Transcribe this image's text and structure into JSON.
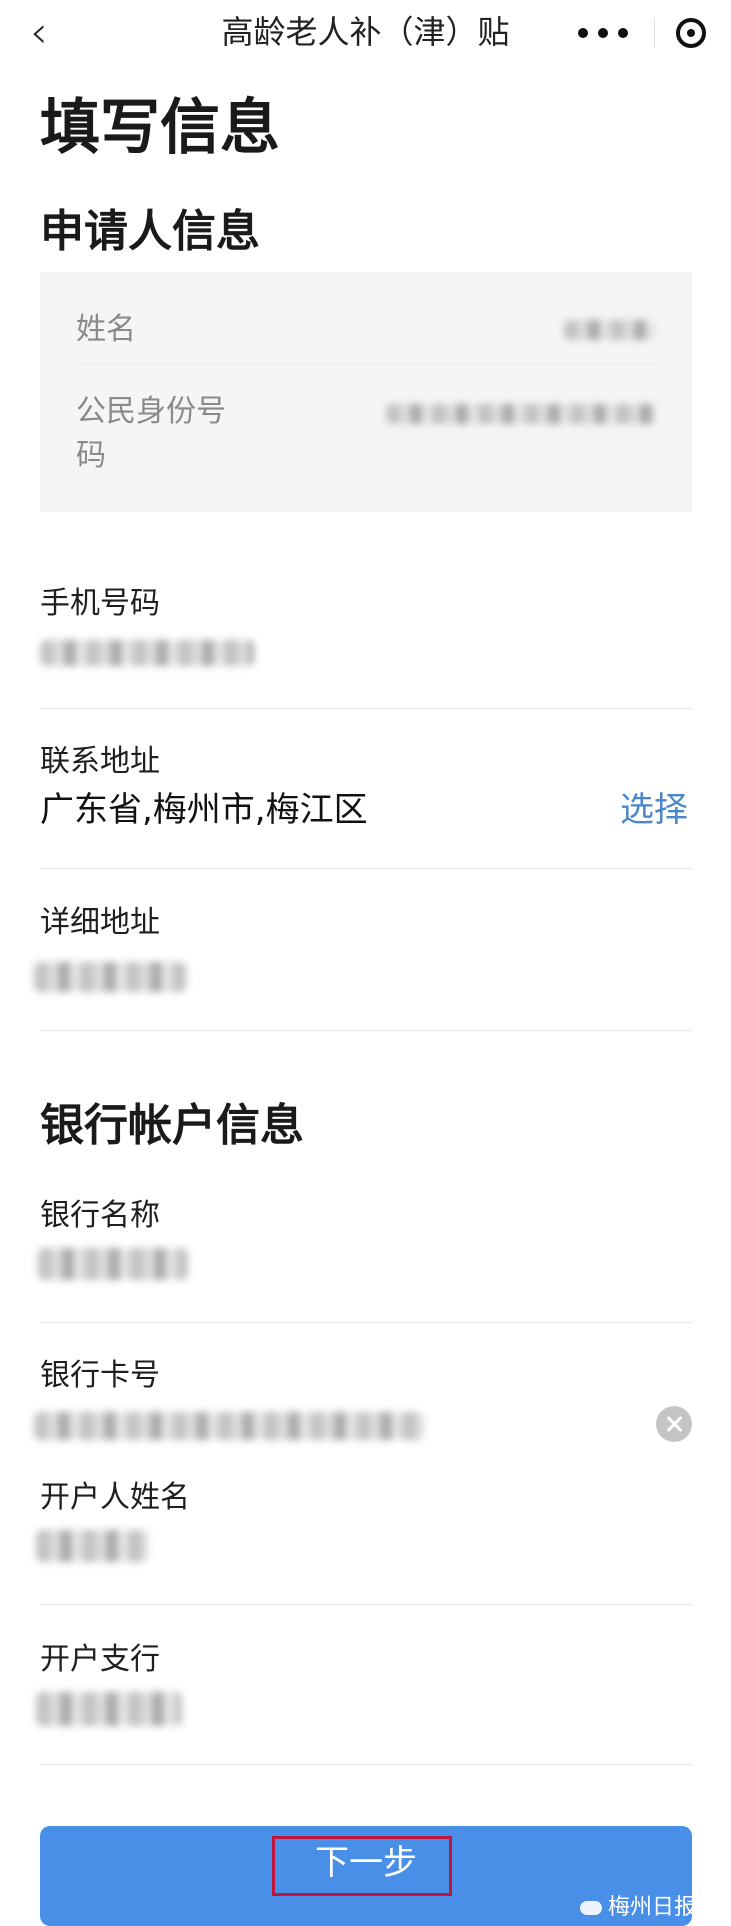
{
  "nav": {
    "title": "高龄老人补（津）贴"
  },
  "page_title": "填写信息",
  "applicant_section": {
    "title": "申请人信息",
    "name_label": "姓名",
    "id_label_line1": "公民身份号",
    "id_label_line2": "码"
  },
  "fields": {
    "phone_label": "手机号码",
    "address_label": "联系地址",
    "address_value": "广东省,梅州市,梅江区",
    "select_label": "选择",
    "detail_address_label": "详细地址"
  },
  "bank_section": {
    "title": "银行帐户信息",
    "bank_name_label": "银行名称",
    "card_number_label": "银行卡号",
    "holder_name_label": "开户人姓名",
    "branch_label": "开户支行"
  },
  "footer": {
    "next_label": "下一步",
    "watermark": "梅州日报"
  },
  "icons": {
    "back": "chevron-left-icon",
    "more": "more-dots-icon",
    "target": "target-icon",
    "clear": "clear-icon",
    "wechat": "wechat-icon"
  },
  "colors": {
    "accent": "#4a8fe7",
    "link": "#4a86c8",
    "highlight_frame": "#c0143c"
  }
}
